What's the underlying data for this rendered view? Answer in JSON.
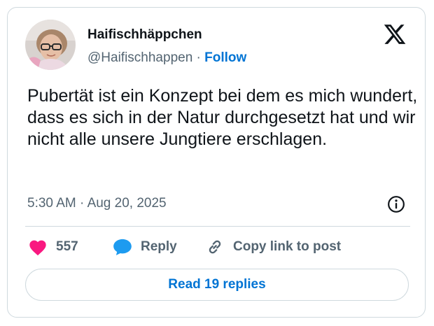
{
  "author": {
    "display_name": "Haifischhäppchen",
    "handle": "@Haifischhappen",
    "separator": "·",
    "follow_label": "Follow"
  },
  "tweet": {
    "text": "Pubertät ist ein Konzept bei dem es mich wundert, dass es sich in der Natur durchgesetzt hat und wir nicht alle unsere Jungtiere erschlagen.",
    "time": "5:30 AM",
    "separator": "·",
    "date": "Aug 20, 2025"
  },
  "actions": {
    "like_count": "557",
    "reply_label": "Reply",
    "copy_link_label": "Copy link to post"
  },
  "footer": {
    "read_replies_label": "Read 19 replies"
  },
  "colors": {
    "like": "#f91880",
    "reply": "#1d9bf0",
    "link": "#0074d4",
    "secondary_text": "#536471",
    "border": "#cfd9de"
  },
  "icons": {
    "brand": "x-logo-icon",
    "info": "info-icon",
    "like": "heart-icon",
    "reply": "speech-bubble-icon",
    "copy_link": "chain-link-icon"
  }
}
